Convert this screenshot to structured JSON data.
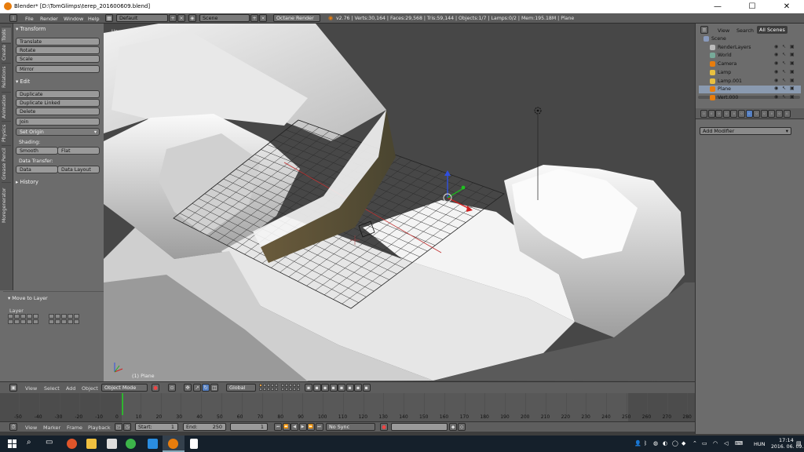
{
  "window": {
    "title": "Blender* [D:\\TomGlimps\\terep_201600609.blend]",
    "min": "—",
    "max": "☐",
    "close": "✕"
  },
  "infobar": {
    "menus": [
      "File",
      "Render",
      "Window",
      "Help"
    ],
    "layout": "Default",
    "scene": "Scene",
    "engine": "Octane Render",
    "stats": "v2.76 | Verts:30,164 | Faces:29,568 | Tris:59,144 | Objects:1/7 | Lamps:0/2 | Mem:195.18M | Plane"
  },
  "toolshelf": {
    "tabs": [
      "Tools",
      "Create",
      "Relations",
      "Animation",
      "Physics",
      "Grease Pencil",
      "Moregenerator"
    ],
    "transform": {
      "header": "Transform",
      "buttons": [
        "Translate",
        "Rotate",
        "Scale",
        "Mirror"
      ]
    },
    "edit": {
      "header": "Edit",
      "buttons": [
        "Duplicate",
        "Duplicate Linked",
        "Delete",
        "Join"
      ],
      "set_origin": "Set Origin",
      "shading_label": "Shading:",
      "smooth": "Smooth",
      "flat": "Flat",
      "data_transfer_label": "Data Transfer:",
      "data": "Data",
      "data_layout": "Data Layout"
    },
    "history": "History",
    "last_op": {
      "header": "Move to Layer",
      "layer_label": "Layer"
    }
  },
  "viewport": {
    "view_name": "User Ortho",
    "object_label": "(1) Plane"
  },
  "outliner": {
    "tabs": [
      "View",
      "Search",
      "All Scenes"
    ],
    "items": [
      {
        "name": "Scene",
        "indent": 0
      },
      {
        "name": "RenderLayers",
        "indent": 1
      },
      {
        "name": "World",
        "indent": 1
      },
      {
        "name": "Camera",
        "indent": 1
      },
      {
        "name": "Lamp",
        "indent": 1
      },
      {
        "name": "Lamp.001",
        "indent": 1
      },
      {
        "name": "Plane",
        "indent": 1
      },
      {
        "name": "Vert.000",
        "indent": 1
      }
    ]
  },
  "properties": {
    "add_modifier": "Add Modifier"
  },
  "view3d_header": {
    "menus": [
      "View",
      "Select",
      "Add",
      "Object"
    ],
    "mode": "Object Mode",
    "orientation": "Global"
  },
  "timeline": {
    "ticks": [
      "-50",
      "-40",
      "-30",
      "-20",
      "-10",
      "0",
      "10",
      "20",
      "30",
      "40",
      "50",
      "60",
      "70",
      "80",
      "90",
      "100",
      "110",
      "120",
      "130",
      "140",
      "150",
      "160",
      "170",
      "180",
      "190",
      "200",
      "210",
      "220",
      "230",
      "240",
      "250",
      "260",
      "270",
      "280"
    ],
    "menus": [
      "View",
      "Marker",
      "Frame",
      "Playback"
    ],
    "start": "Start:",
    "start_val": "1",
    "end": "End:",
    "end_val": "250",
    "current": "1",
    "sync": "No Sync"
  },
  "taskbar": {
    "lang": "HUN",
    "time": "17:14",
    "date": "2016. 06. 09."
  },
  "colors": {
    "accent": "#e87d0d",
    "selected_blue": "#5680c2",
    "frame_green": "#2fb52f"
  }
}
